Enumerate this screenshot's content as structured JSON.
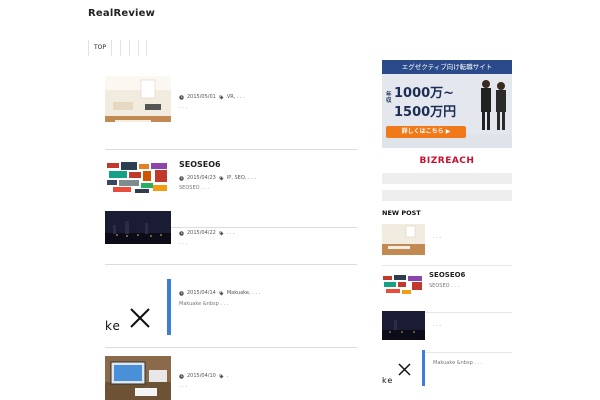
{
  "site": {
    "title": "RealReview"
  },
  "nav": {
    "items": [
      "TOP"
    ]
  },
  "posts": [
    {
      "title": "",
      "date": "2015/05/01",
      "tags": "VR, . . .",
      "excerpt": ". . ."
    },
    {
      "title": "SEOSEO6",
      "date": "2015/04/23",
      "tags": "IP, SEO, . . .",
      "excerpt": "SEOSEO . . ."
    },
    {
      "title": "",
      "date": "2015/04/22",
      "tags": ". . .",
      "excerpt": ". . ."
    },
    {
      "title": "",
      "date": "2015/04/14",
      "tags": "Makuake, . . .",
      "excerpt": "Makuake &nbsp . . ."
    },
    {
      "title": "",
      "date": "2015/04/10",
      "tags": ".",
      "excerpt": ". . ."
    }
  ],
  "ad": {
    "headline": "エグゼクティブ向け転職サイト",
    "income_prefix": "年収",
    "income_line1": "1000万~",
    "income_line2": "1500万円",
    "cta": "詳しくはこちら ▶",
    "brand": "BIZREACH"
  },
  "sidebar": {
    "new_post_title": "NEW POST",
    "posts": [
      {
        "title": "",
        "excerpt": ". . ."
      },
      {
        "title": "SEOSEO6",
        "excerpt": "SEOSEO . . ."
      },
      {
        "title": "",
        "excerpt": ". . ."
      },
      {
        "title": "",
        "excerpt": "Makuake &nbsp . . ."
      }
    ]
  },
  "thumb_text": {
    "makuake": "ke"
  },
  "colors": {
    "accent_blue": "#3b7dd8",
    "ad_orange": "#f07a1a",
    "ad_red": "#c8102e"
  }
}
